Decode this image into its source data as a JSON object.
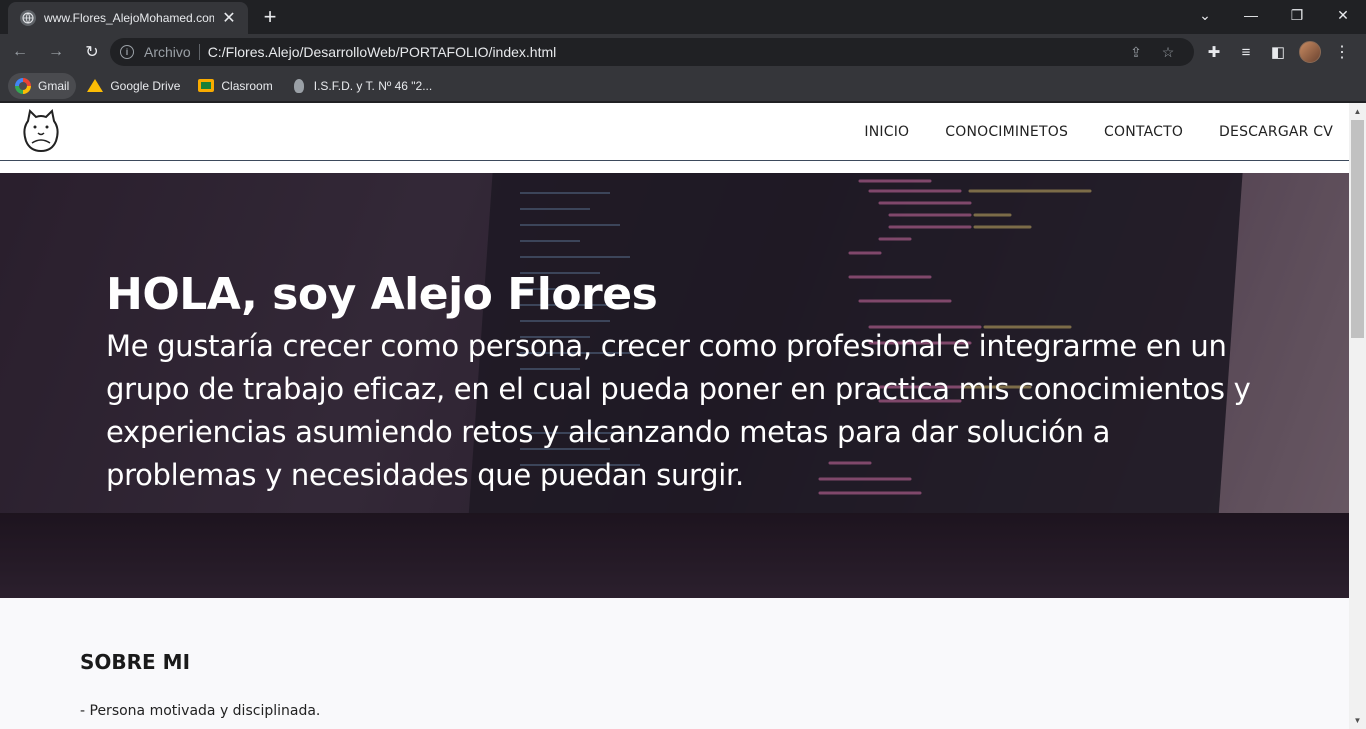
{
  "browser": {
    "tab_title": "www.Flores_AlejoMohamed.com",
    "new_tab_label": "+",
    "scheme_label": "Archivo",
    "url": "C:/Flores.Alejo/DesarrolloWeb/PORTAFOLIO/index.html",
    "bookmarks": [
      {
        "label": "Gmail",
        "icon": "gmail-icon"
      },
      {
        "label": "Google Drive",
        "icon": "google-drive-icon"
      },
      {
        "label": "Clasroom",
        "icon": "classroom-icon"
      },
      {
        "label": "I.S.F.D. y T. Nº 46 \"2...",
        "icon": "isfd-icon"
      }
    ]
  },
  "site": {
    "nav": [
      "INICIO",
      "CONOCIMINETOS",
      "CONTACTO",
      "DESCARGAR CV"
    ],
    "hero_title": "HOLA, soy Alejo Flores",
    "hero_text": "Me gustaría crecer como persona, crecer como profesional e integrarme en un grupo de trabajo eficaz, en el cual pueda poner en practica mis conocimientos y experiencias asumiendo retos y alcanzando metas para dar solución a problemas y necesidades que puedan surgir.",
    "about_title": "SOBRE MI",
    "about_items": [
      "- Persona motivada y disciplinada."
    ]
  },
  "colors": {
    "header_border": "#3d4a5c",
    "hero_text": "#ffffff",
    "chrome_dark": "#202124",
    "chrome_toolbar": "#35363a"
  }
}
